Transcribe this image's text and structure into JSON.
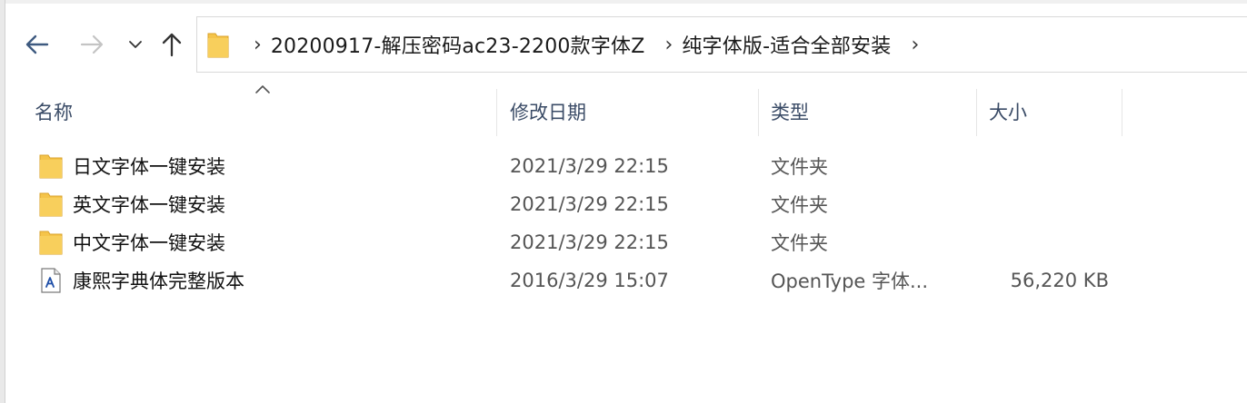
{
  "navigation": {
    "back_icon": "arrow-left-icon",
    "forward_icon": "arrow-right-icon",
    "recent_icon": "chevron-down-icon",
    "up_icon": "arrow-up-icon"
  },
  "address_bar": {
    "folder_icon": "folder-icon",
    "crumbs": [
      "20200917-解压密码ac23-2200款字体Z",
      "纯字体版-适合全部安装"
    ],
    "separator": "›"
  },
  "columns": {
    "name": "名称",
    "modified": "修改日期",
    "type": "类型",
    "size": "大小",
    "sort_indicator": "sort-ascending-icon"
  },
  "files": [
    {
      "name": "日文字体一键安装",
      "modified": "2021/3/29 22:15",
      "type": "文件夹",
      "size": "",
      "icon": "folder-icon"
    },
    {
      "name": "英文字体一键安装",
      "modified": "2021/3/29 22:15",
      "type": "文件夹",
      "size": "",
      "icon": "folder-icon"
    },
    {
      "name": "中文字体一键安装",
      "modified": "2021/3/29 22:15",
      "type": "文件夹",
      "size": "",
      "icon": "folder-icon"
    },
    {
      "name": "康熙字典体完整版本",
      "modified": "2016/3/29 15:07",
      "type": "OpenType 字体...",
      "size": "56,220 KB",
      "icon": "font-file-icon"
    }
  ],
  "colors": {
    "folder": "#f5c44a",
    "header_text": "#3a4b66",
    "nav_active": "#3e5a80",
    "nav_disabled": "#c4c4c4"
  }
}
